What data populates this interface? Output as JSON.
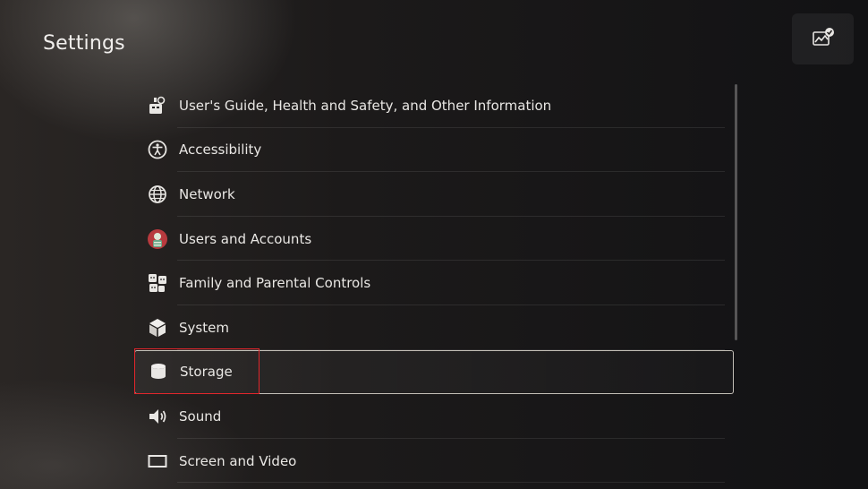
{
  "header": {
    "title": "Settings",
    "capture_icon": "gallery-check-icon"
  },
  "menu": {
    "items": [
      {
        "label": "User's Guide, Health and Safety, and Other Information",
        "icon": "guide-icon"
      },
      {
        "label": "Accessibility",
        "icon": "accessibility-icon"
      },
      {
        "label": "Network",
        "icon": "globe-icon"
      },
      {
        "label": "Users and Accounts",
        "icon": "user-avatar-icon"
      },
      {
        "label": "Family and Parental Controls",
        "icon": "family-icon"
      },
      {
        "label": "System",
        "icon": "cube-icon"
      },
      {
        "label": "Storage",
        "icon": "storage-icon"
      },
      {
        "label": "Sound",
        "icon": "speaker-icon"
      },
      {
        "label": "Screen and Video",
        "icon": "screen-icon"
      }
    ],
    "selected_index": 6
  },
  "colors": {
    "highlight": "#e2262c",
    "selection_border": "#e1dcd2"
  }
}
